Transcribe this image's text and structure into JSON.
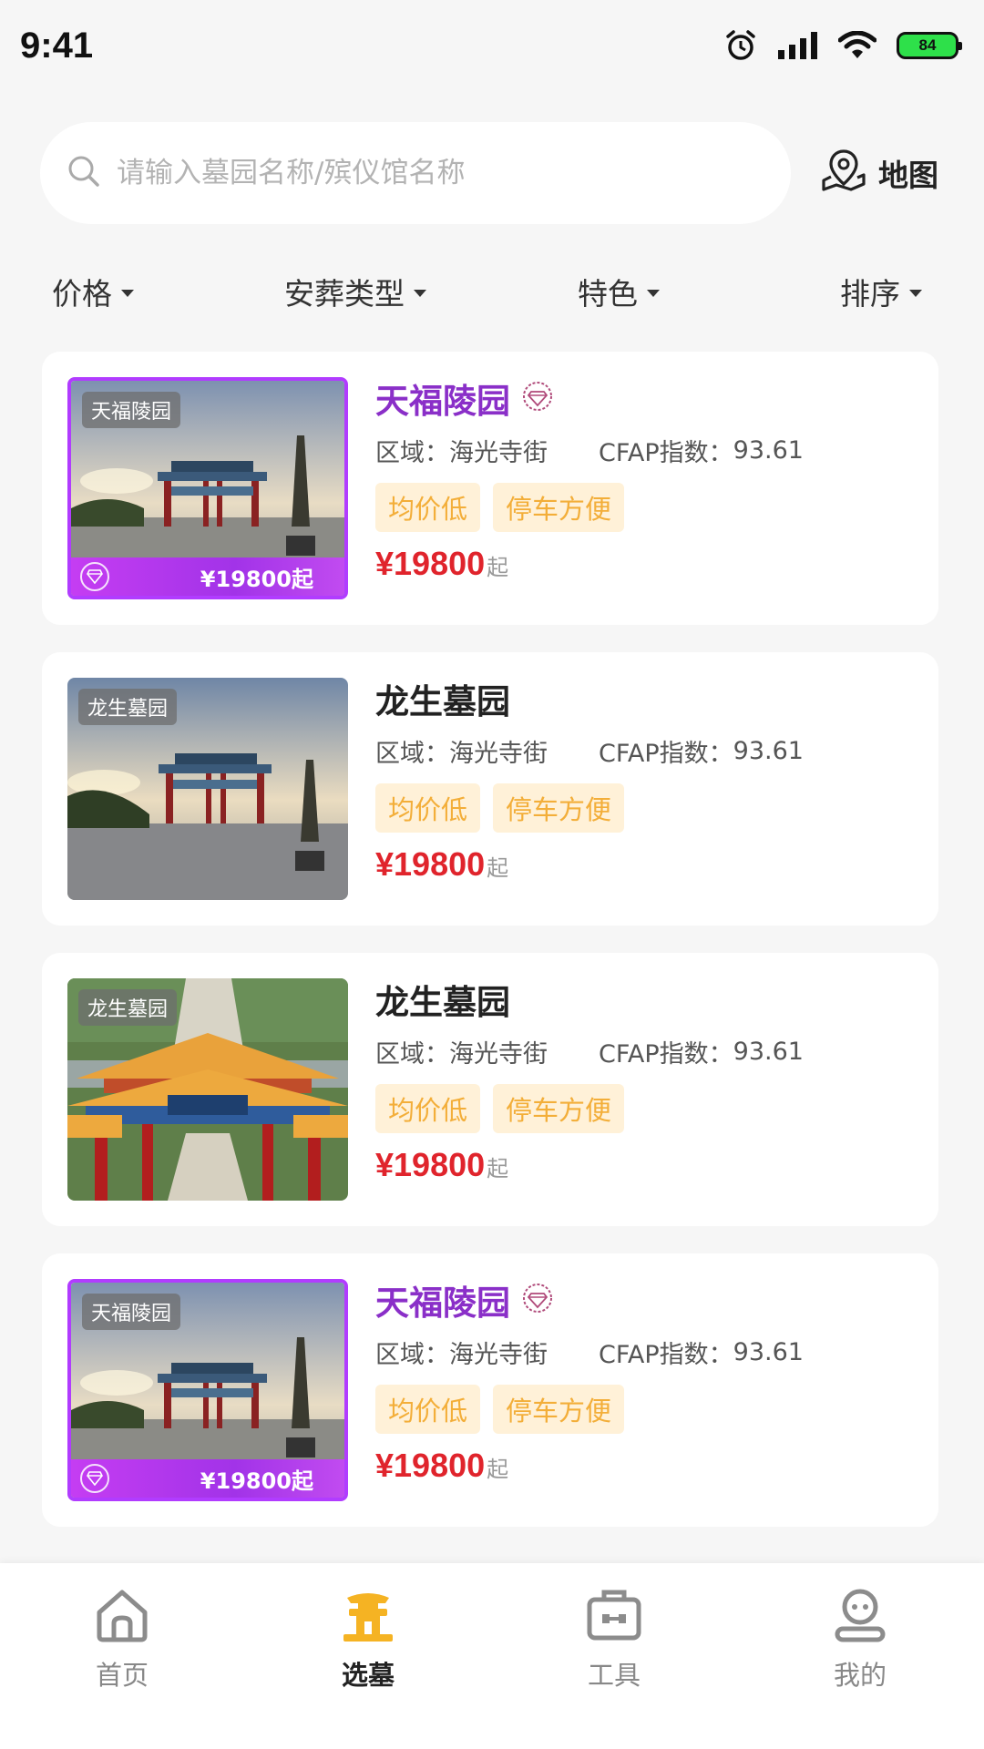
{
  "status_bar": {
    "time": "9:41",
    "battery": "84"
  },
  "search": {
    "placeholder": "请输入墓园名称/殡仪馆名称",
    "value": ""
  },
  "map_button": {
    "label": "地图",
    "icon": "map-pin-icon"
  },
  "filters": [
    {
      "label": "价格"
    },
    {
      "label": "安葬类型"
    },
    {
      "label": "特色"
    },
    {
      "label": "排序"
    }
  ],
  "cemeteries": [
    {
      "thumb_tag": "天福陵园",
      "thumb_price": "¥19800起",
      "premium": true,
      "name": "天福陵园",
      "region_label": "区域：",
      "region": "海光寺街",
      "cfap_label": "CFAP指数：",
      "cfap": "93.61",
      "tags": [
        "均价低",
        "停车方便"
      ],
      "price": "¥19800",
      "price_suffix": "起"
    },
    {
      "thumb_tag": "龙生墓园",
      "thumb_price": "",
      "premium": false,
      "name": "龙生墓园",
      "region_label": "区域：",
      "region": "海光寺街",
      "cfap_label": "CFAP指数：",
      "cfap": "93.61",
      "tags": [
        "均价低",
        "停车方便"
      ],
      "price": "¥19800",
      "price_suffix": "起"
    },
    {
      "thumb_tag": "龙生墓园",
      "thumb_price": "",
      "premium": false,
      "name": "龙生墓园",
      "region_label": "区域：",
      "region": "海光寺街",
      "cfap_label": "CFAP指数：",
      "cfap": "93.61",
      "tags": [
        "均价低",
        "停车方便"
      ],
      "price": "¥19800",
      "price_suffix": "起"
    },
    {
      "thumb_tag": "天福陵园",
      "thumb_price": "¥19800起",
      "premium": true,
      "name": "天福陵园",
      "region_label": "区域：",
      "region": "海光寺街",
      "cfap_label": "CFAP指数：",
      "cfap": "93.61",
      "tags": [
        "均价低",
        "停车方便"
      ],
      "price": "¥19800",
      "price_suffix": "起"
    }
  ],
  "tabbar": [
    {
      "label": "首页",
      "icon": "home-icon",
      "active": false
    },
    {
      "label": "选墓",
      "icon": "pagoda-icon",
      "active": true
    },
    {
      "label": "工具",
      "icon": "toolbox-icon",
      "active": false
    },
    {
      "label": "我的",
      "icon": "profile-icon",
      "active": false
    }
  ],
  "colors": {
    "accent": "#f5b323",
    "price": "#e0242c",
    "premium": "#8a2fc8",
    "tag_bg": "#fff1d8",
    "tag_text": "#f3ae39"
  }
}
